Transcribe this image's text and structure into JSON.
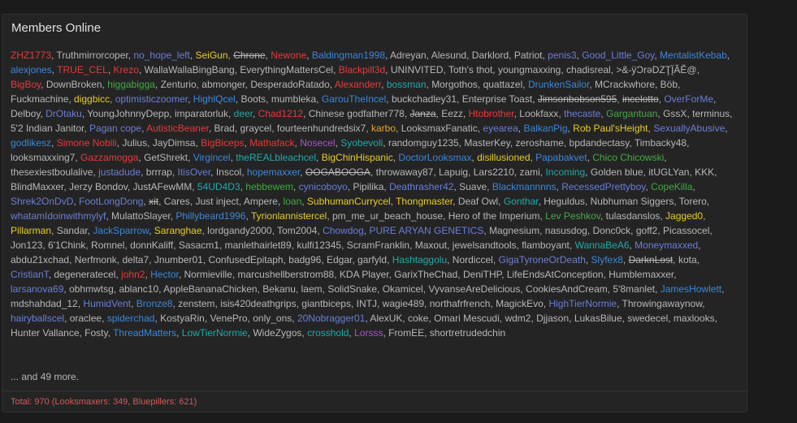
{
  "panel": {
    "title": "Members Online",
    "more_text": "... and 49 more.",
    "total_text": "Total: 970 (Looksmaxers: 349, Bluepillers: 621)"
  },
  "colors": {
    "default": "#b8b8b8",
    "red": "#e53b3b",
    "blue": "#3d88d9",
    "yellow": "#e8cd2d",
    "green": "#44aa44",
    "teal": "#23aaa8",
    "purple": "#a857c8",
    "orange": "#e8a72c",
    "indigo": "#6b7fd6"
  },
  "members": [
    {
      "n": "ZHZ1773",
      "c": "red"
    },
    {
      "n": "Truthmirrorcoper",
      "c": "default"
    },
    {
      "n": "no_hope_left",
      "c": "indigo"
    },
    {
      "n": "SeiGun",
      "c": "yellow"
    },
    {
      "n": "Chrone",
      "c": "default",
      "s": true
    },
    {
      "n": "Newone",
      "c": "red"
    },
    {
      "n": "Baldingman1998",
      "c": "blue"
    },
    {
      "n": "Adreyan",
      "c": "default"
    },
    {
      "n": "Alesund",
      "c": "default"
    },
    {
      "n": "Darklord",
      "c": "default"
    },
    {
      "n": "Patriot",
      "c": "default"
    },
    {
      "n": "penis3",
      "c": "indigo"
    },
    {
      "n": "Good_Little_Goy",
      "c": "indigo"
    },
    {
      "n": "MentalistKebab",
      "c": "blue"
    },
    {
      "n": "alexjones",
      "c": "blue"
    },
    {
      "n": "TRUE_CEL",
      "c": "red"
    },
    {
      "n": "Krezo",
      "c": "red"
    },
    {
      "n": "WallaWallaBingBang",
      "c": "default"
    },
    {
      "n": "EverythingMattersCel",
      "c": "default"
    },
    {
      "n": "Blackpill3d",
      "c": "red"
    },
    {
      "n": "UNINVITED",
      "c": "default"
    },
    {
      "n": "Toth's thot",
      "c": "default"
    },
    {
      "n": "youngmaxxing",
      "c": "default"
    },
    {
      "n": "chadisreal",
      "c": "default"
    },
    {
      "n": ">&-ÿƆrǝDZŢĮ̈ĂĚ@",
      "c": "default"
    },
    {
      "n": "BigBoy",
      "c": "red"
    },
    {
      "n": "DownBroken",
      "c": "default"
    },
    {
      "n": "higgabigga",
      "c": "green"
    },
    {
      "n": "Zenturio",
      "c": "default"
    },
    {
      "n": "abmonger",
      "c": "default"
    },
    {
      "n": "DesperadoRatado",
      "c": "default"
    },
    {
      "n": "Alexanderr",
      "c": "red"
    },
    {
      "n": "bossman",
      "c": "teal"
    },
    {
      "n": "Morgothos",
      "c": "default"
    },
    {
      "n": "quattazel",
      "c": "default"
    },
    {
      "n": "DrunkenSailor",
      "c": "blue"
    },
    {
      "n": "MCrackwhore",
      "c": "default"
    },
    {
      "n": "Böb",
      "c": "default"
    },
    {
      "n": "Fuckmachine",
      "c": "default"
    },
    {
      "n": "diggbicc",
      "c": "yellow"
    },
    {
      "n": "optimisticzoomer",
      "c": "indigo"
    },
    {
      "n": "HighlQcel",
      "c": "blue"
    },
    {
      "n": "Boots",
      "c": "default"
    },
    {
      "n": "mumbleka",
      "c": "default"
    },
    {
      "n": "GarouTheIncel",
      "c": "blue"
    },
    {
      "n": "buckchadley31",
      "c": "default"
    },
    {
      "n": "Enterprise Toast",
      "c": "default"
    },
    {
      "n": "Jimsonbobson595",
      "c": "default",
      "s": true
    },
    {
      "n": "incelotto",
      "c": "default",
      "s": true
    },
    {
      "n": "OverForMe",
      "c": "indigo"
    },
    {
      "n": "Delboy",
      "c": "default"
    },
    {
      "n": "DrOtaku",
      "c": "indigo"
    },
    {
      "n": "YoungJohnnyDepp",
      "c": "default"
    },
    {
      "n": "imparatorluk",
      "c": "default"
    },
    {
      "n": "deer",
      "c": "teal"
    },
    {
      "n": "Chad1212",
      "c": "red"
    },
    {
      "n": "Chinese godfather778",
      "c": "default"
    },
    {
      "n": "Janza",
      "c": "default",
      "s": true
    },
    {
      "n": "Eezz",
      "c": "default"
    },
    {
      "n": "Htobrother",
      "c": "red"
    },
    {
      "n": "Lookfaxx",
      "c": "default"
    },
    {
      "n": "thecaste",
      "c": "indigo"
    },
    {
      "n": "Gargantuan",
      "c": "green"
    },
    {
      "n": "GssX",
      "c": "default"
    },
    {
      "n": "terminus",
      "c": "default"
    },
    {
      "n": "5'2 Indian Janitor",
      "c": "default"
    },
    {
      "n": "Pagan cope",
      "c": "indigo"
    },
    {
      "n": "AutisticBeaner",
      "c": "red"
    },
    {
      "n": "Brad",
      "c": "default"
    },
    {
      "n": "graycel",
      "c": "default"
    },
    {
      "n": "fourteenhundredsix7",
      "c": "default"
    },
    {
      "n": "karbo",
      "c": "orange"
    },
    {
      "n": "LooksmaxFanatic",
      "c": "default"
    },
    {
      "n": "eyearea",
      "c": "indigo"
    },
    {
      "n": "BalkanPig",
      "c": "blue"
    },
    {
      "n": "Rob Paul'sHeight",
      "c": "yellow"
    },
    {
      "n": "SexuallyAbusive",
      "c": "indigo"
    },
    {
      "n": "godlikesz",
      "c": "blue"
    },
    {
      "n": "Simone Nobili",
      "c": "red"
    },
    {
      "n": "Julius",
      "c": "default"
    },
    {
      "n": "JayDimsa",
      "c": "default"
    },
    {
      "n": "BigBiceps",
      "c": "red"
    },
    {
      "n": "Mathafack",
      "c": "red"
    },
    {
      "n": "Nosecel",
      "c": "purple"
    },
    {
      "n": "Syobevoli",
      "c": "teal"
    },
    {
      "n": "randomguy1235",
      "c": "default"
    },
    {
      "n": "MasterKey",
      "c": "default"
    },
    {
      "n": "zeroshame",
      "c": "default"
    },
    {
      "n": "bpdandectasy",
      "c": "default"
    },
    {
      "n": "Timbacky48",
      "c": "default"
    },
    {
      "n": "looksmaxxing7",
      "c": "default"
    },
    {
      "n": "Gazzamogga",
      "c": "red"
    },
    {
      "n": "GetShrekt",
      "c": "default"
    },
    {
      "n": "Virgincel",
      "c": "blue"
    },
    {
      "n": "theREALbleachcel",
      "c": "teal"
    },
    {
      "n": "BigChinHispanic",
      "c": "yellow"
    },
    {
      "n": "DoctorLooksmax",
      "c": "blue"
    },
    {
      "n": "disillusioned",
      "c": "yellow"
    },
    {
      "n": "Papabakvet",
      "c": "blue"
    },
    {
      "n": "Chico Chicowski",
      "c": "green"
    },
    {
      "n": "thesexiestboulalive",
      "c": "default"
    },
    {
      "n": "justadude",
      "c": "indigo"
    },
    {
      "n": "brrrap",
      "c": "default"
    },
    {
      "n": "ItisOver",
      "c": "indigo"
    },
    {
      "n": "Inscol",
      "c": "default"
    },
    {
      "n": "hopemaxxer",
      "c": "blue"
    },
    {
      "n": "OOGABOOGA",
      "c": "default",
      "s": true
    },
    {
      "n": "throwaway87",
      "c": "default"
    },
    {
      "n": "Lapuig",
      "c": "default"
    },
    {
      "n": "Lars2210",
      "c": "default"
    },
    {
      "n": "zami",
      "c": "default"
    },
    {
      "n": "Incoming",
      "c": "teal"
    },
    {
      "n": "Golden blue",
      "c": "default"
    },
    {
      "n": "itUGLYan",
      "c": "default"
    },
    {
      "n": "KKK",
      "c": "default"
    },
    {
      "n": "BlindMaxxer",
      "c": "default"
    },
    {
      "n": "Jerzy Bondov",
      "c": "default"
    },
    {
      "n": "JustAFewMM",
      "c": "default"
    },
    {
      "n": "54UD4D3",
      "c": "teal"
    },
    {
      "n": "hebbewem",
      "c": "green"
    },
    {
      "n": "cynicoboyo",
      "c": "indigo"
    },
    {
      "n": "Pipilika",
      "c": "default"
    },
    {
      "n": "Deathrasher42",
      "c": "indigo"
    },
    {
      "n": "Suave",
      "c": "default"
    },
    {
      "n": "Blackmannnns",
      "c": "blue"
    },
    {
      "n": "RecessedPrettyboy",
      "c": "indigo"
    },
    {
      "n": "CopeKilla",
      "c": "green"
    },
    {
      "n": "Shrek2OnDvD",
      "c": "indigo"
    },
    {
      "n": "FootLongDong",
      "c": "indigo"
    },
    {
      "n": "xit",
      "c": "default",
      "s": true
    },
    {
      "n": "Cares",
      "c": "default"
    },
    {
      "n": "Just inject",
      "c": "default"
    },
    {
      "n": "Ampere",
      "c": "default"
    },
    {
      "n": "loan",
      "c": "green"
    },
    {
      "n": "SubhumanCurrycel",
      "c": "yellow"
    },
    {
      "n": "Thongmaster",
      "c": "yellow"
    },
    {
      "n": "Deaf Owl",
      "c": "default"
    },
    {
      "n": "Gonthar",
      "c": "teal"
    },
    {
      "n": "Heguldus",
      "c": "default"
    },
    {
      "n": "Nubhuman Siggers",
      "c": "default"
    },
    {
      "n": "Torero",
      "c": "default"
    },
    {
      "n": "whatamIdoinwithmylyf",
      "c": "indigo"
    },
    {
      "n": "MulattoSlayer",
      "c": "default"
    },
    {
      "n": "Phillybeard1996",
      "c": "blue"
    },
    {
      "n": "Tyrionlannistercel",
      "c": "yellow"
    },
    {
      "n": "pm_me_ur_beach_house",
      "c": "default"
    },
    {
      "n": "Hero of the Imperium",
      "c": "default"
    },
    {
      "n": "Lev Peshkov",
      "c": "green"
    },
    {
      "n": "tulasdanslos",
      "c": "default"
    },
    {
      "n": "Jagged0",
      "c": "yellow"
    },
    {
      "n": "Pillarman",
      "c": "yellow"
    },
    {
      "n": "Sandar",
      "c": "default"
    },
    {
      "n": "JackSparrow",
      "c": "blue"
    },
    {
      "n": "Saranghae",
      "c": "yellow"
    },
    {
      "n": "lordgandy2000",
      "c": "default"
    },
    {
      "n": "Tom2004",
      "c": "default"
    },
    {
      "n": "Chowdog",
      "c": "indigo"
    },
    {
      "n": "PURE ARYAN GENETICS",
      "c": "indigo"
    },
    {
      "n": "Magnesium",
      "c": "default"
    },
    {
      "n": "nasusdog",
      "c": "default"
    },
    {
      "n": "Donc0ck",
      "c": "default"
    },
    {
      "n": "goff2",
      "c": "default"
    },
    {
      "n": "Picassocel",
      "c": "default"
    },
    {
      "n": "Jon123",
      "c": "default"
    },
    {
      "n": "6'1Chink",
      "c": "default"
    },
    {
      "n": "Romnel",
      "c": "default"
    },
    {
      "n": "donnKaliff",
      "c": "default"
    },
    {
      "n": "Sasacm1",
      "c": "default"
    },
    {
      "n": "manlethairlet89",
      "c": "default"
    },
    {
      "n": "kulfi12345",
      "c": "default"
    },
    {
      "n": "ScramFranklin",
      "c": "default"
    },
    {
      "n": "Maxout",
      "c": "default"
    },
    {
      "n": "jewelsandtools",
      "c": "default"
    },
    {
      "n": "flamboyant",
      "c": "default"
    },
    {
      "n": "WannaBeA6",
      "c": "teal"
    },
    {
      "n": "Moneymaxxed",
      "c": "indigo"
    },
    {
      "n": "abdu21xchad",
      "c": "default"
    },
    {
      "n": "Nerfmonk",
      "c": "default"
    },
    {
      "n": "delta7",
      "c": "default"
    },
    {
      "n": "Jnumber01",
      "c": "default"
    },
    {
      "n": "ConfusedEpitaph",
      "c": "default"
    },
    {
      "n": "badg96",
      "c": "default"
    },
    {
      "n": "Edgar",
      "c": "default"
    },
    {
      "n": "garfyld",
      "c": "default"
    },
    {
      "n": "Hashtaggolu",
      "c": "teal"
    },
    {
      "n": "Nordiccel",
      "c": "default"
    },
    {
      "n": "GigaTyroneOrDeath",
      "c": "indigo"
    },
    {
      "n": "Slyfex8",
      "c": "blue"
    },
    {
      "n": "DarknLost",
      "c": "default",
      "s": true
    },
    {
      "n": "kota",
      "c": "default"
    },
    {
      "n": "CristianT",
      "c": "indigo"
    },
    {
      "n": "degeneratecel",
      "c": "default"
    },
    {
      "n": "john2",
      "c": "red"
    },
    {
      "n": "Hector",
      "c": "blue"
    },
    {
      "n": "Normieville",
      "c": "default"
    },
    {
      "n": "marcushellberstrom88",
      "c": "default"
    },
    {
      "n": "KDA Player",
      "c": "default"
    },
    {
      "n": "GarixTheChad",
      "c": "default"
    },
    {
      "n": "DeniTHP",
      "c": "default"
    },
    {
      "n": "LifeEndsAtConception",
      "c": "default"
    },
    {
      "n": "Humblemaxxer",
      "c": "default"
    },
    {
      "n": "larsanova69",
      "c": "indigo"
    },
    {
      "n": "obhmwtsg",
      "c": "default"
    },
    {
      "n": "ablanc10",
      "c": "default"
    },
    {
      "n": "AppleBananaChicken",
      "c": "default"
    },
    {
      "n": "Bekanu",
      "c": "default"
    },
    {
      "n": "laem",
      "c": "default"
    },
    {
      "n": "SolidSnake",
      "c": "default"
    },
    {
      "n": "Okamicel",
      "c": "default"
    },
    {
      "n": "VyvanseAreDelicious",
      "c": "default"
    },
    {
      "n": "CookiesAndCream",
      "c": "default"
    },
    {
      "n": "5'8manlet",
      "c": "default"
    },
    {
      "n": "JamesHowlett",
      "c": "blue"
    },
    {
      "n": "mdshahdad_12",
      "c": "default"
    },
    {
      "n": "HumidVent",
      "c": "indigo"
    },
    {
      "n": "Bronze8",
      "c": "blue"
    },
    {
      "n": "zenstem",
      "c": "default"
    },
    {
      "n": "isis420deathgrips",
      "c": "default"
    },
    {
      "n": "giantbiceps",
      "c": "default"
    },
    {
      "n": "INTJ",
      "c": "default"
    },
    {
      "n": "wagie489",
      "c": "default"
    },
    {
      "n": "northafrfrench",
      "c": "default"
    },
    {
      "n": "MagickEvo",
      "c": "default"
    },
    {
      "n": "HighTierNormie",
      "c": "indigo"
    },
    {
      "n": "Throwingawaynow",
      "c": "default"
    },
    {
      "n": "hairyballscel",
      "c": "indigo"
    },
    {
      "n": "oraclee",
      "c": "default"
    },
    {
      "n": "spiderchad",
      "c": "blue"
    },
    {
      "n": "KostyaRin",
      "c": "default"
    },
    {
      "n": "VenePro",
      "c": "default"
    },
    {
      "n": "only_ons",
      "c": "default"
    },
    {
      "n": "20Nobragger01",
      "c": "indigo"
    },
    {
      "n": "AlexUK",
      "c": "default"
    },
    {
      "n": "coke",
      "c": "default"
    },
    {
      "n": "Omari Mescudi",
      "c": "default"
    },
    {
      "n": "wdm2",
      "c": "default"
    },
    {
      "n": "Djjason",
      "c": "default"
    },
    {
      "n": "LukasBilue",
      "c": "default"
    },
    {
      "n": "swedecel",
      "c": "default"
    },
    {
      "n": "maxlooks",
      "c": "default"
    },
    {
      "n": "Hunter Vallance",
      "c": "default"
    },
    {
      "n": "Fosty",
      "c": "default"
    },
    {
      "n": "ThreadMatters",
      "c": "blue"
    },
    {
      "n": "LowTierNormie",
      "c": "teal"
    },
    {
      "n": "WideZygos",
      "c": "default"
    },
    {
      "n": "crosshold",
      "c": "teal"
    },
    {
      "n": "Lorsss",
      "c": "purple"
    },
    {
      "n": "FromEE",
      "c": "default"
    },
    {
      "n": "shortretrudedchin",
      "c": "default"
    }
  ]
}
